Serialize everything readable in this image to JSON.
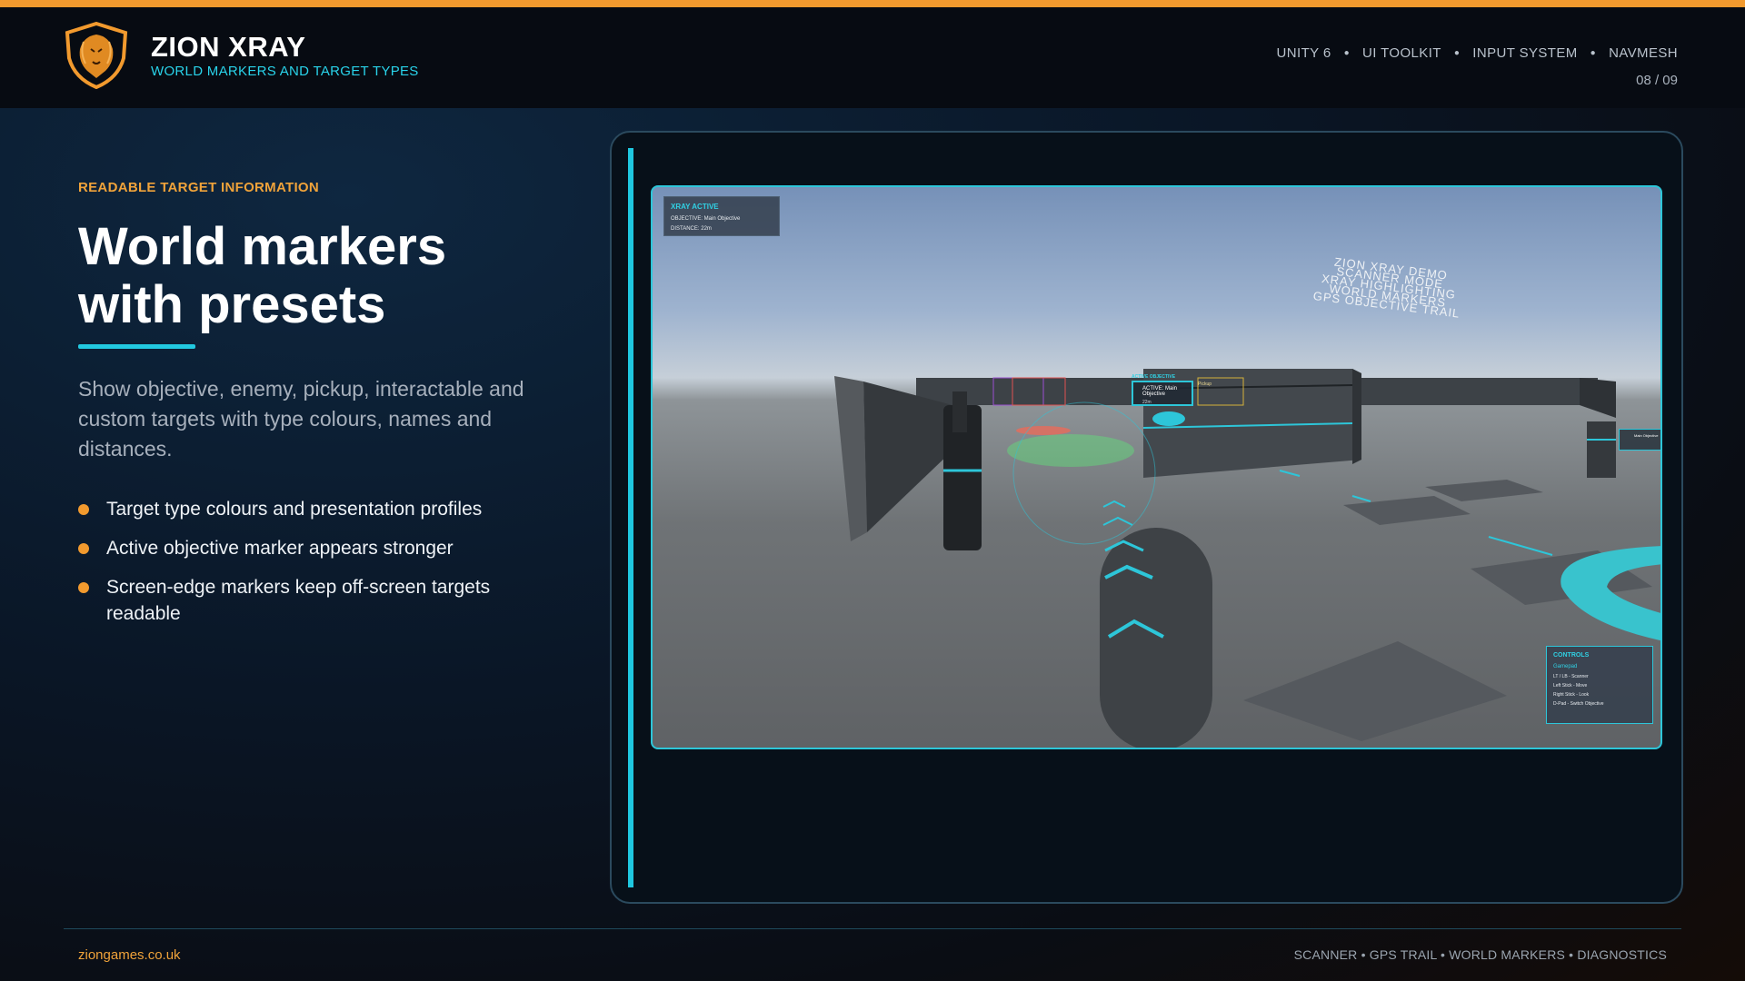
{
  "brand": {
    "title": "ZION XRAY",
    "subtitle": "WORLD MARKERS AND TARGET TYPES"
  },
  "tech": [
    "UNITY 6",
    "UI TOOLKIT",
    "INPUT SYSTEM",
    "NAVMESH"
  ],
  "page": "08 / 09",
  "content": {
    "eyebrow": "READABLE TARGET INFORMATION",
    "headline_line1": "World markers",
    "headline_line2": "with presets",
    "description": "Show objective, enemy, pickup, interactable and custom targets with type colours, names and distances.",
    "bullets": [
      "Target type colours and presentation profiles",
      "Active objective marker appears stronger",
      "Screen-edge markers keep off-screen targets readable"
    ]
  },
  "game": {
    "xray_panel": {
      "title": "XRAY ACTIVE",
      "objective": "OBJECTIVE: Main Objective",
      "distance": "DISTANCE: 22m"
    },
    "world_text": [
      "ZION XRAY DEMO",
      "SCANNER MODE",
      "XRAY HIGHLIGHTING",
      "WORLD MARKERS",
      "GPS OBJECTIVE TRAIL"
    ],
    "active_marker": {
      "tag": "ACTIVE OBJECTIVE",
      "label": "ACTIVE: Main Objective",
      "distance": "22m"
    },
    "pickup_marker": {
      "label": "Pickup"
    },
    "edge_marker": {
      "label": "Main Objective"
    },
    "controls": {
      "title": "CONTROLS",
      "subtitle": "Gamepad",
      "lines": [
        "LT / LB - Scanner",
        "Left Stick - Move",
        "Right Stick - Look",
        "D-Pad - Switch Objective"
      ]
    }
  },
  "footer": {
    "site": "ziongames.co.uk",
    "features": "SCANNER • GPS TRAIL • WORLD MARKERS • DIAGNOSTICS"
  },
  "colors": {
    "accent_orange": "#f29a2e",
    "accent_cyan": "#22c9e0",
    "header_bg": "#070b12"
  }
}
